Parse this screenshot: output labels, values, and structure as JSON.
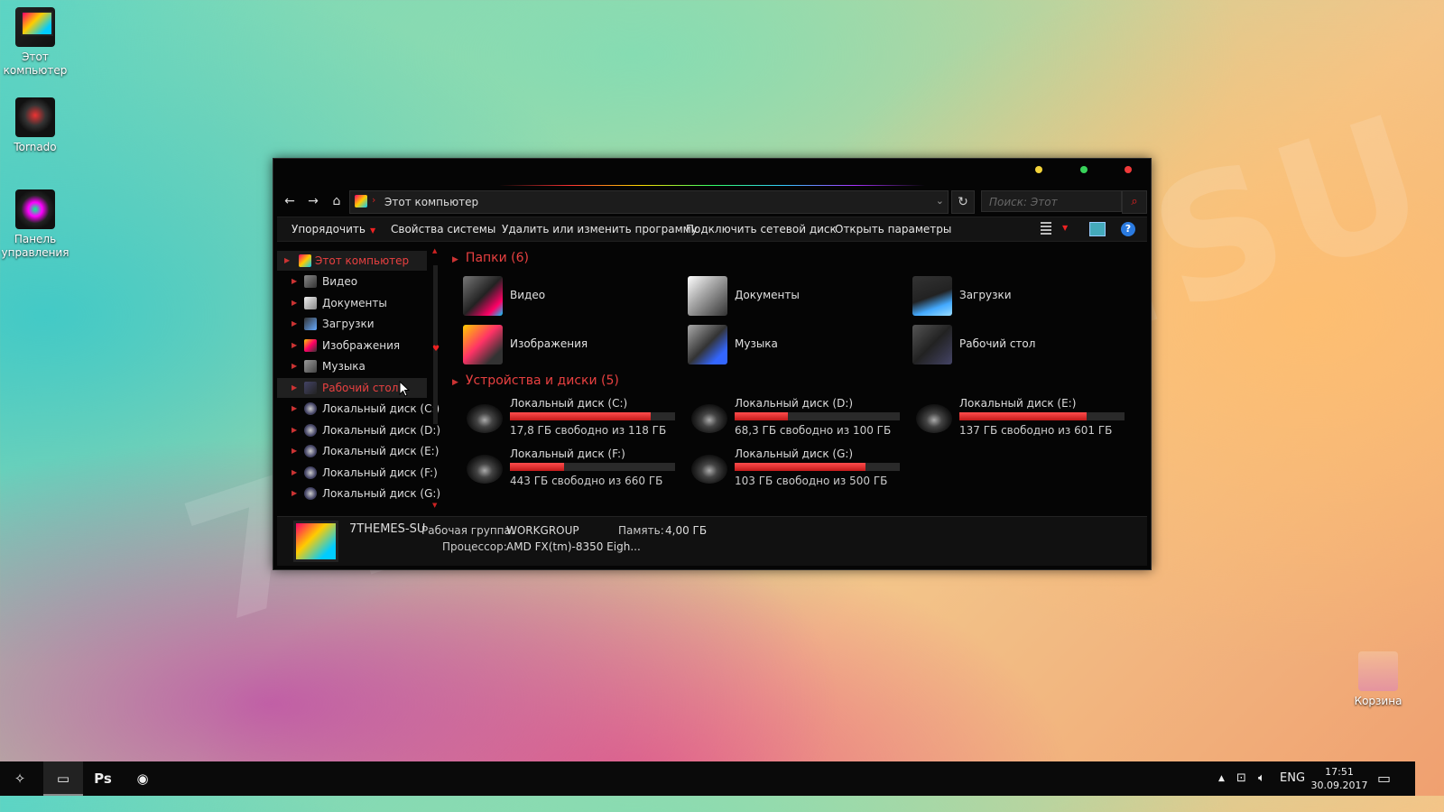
{
  "watermark": "7THEMES.SU",
  "desktop": {
    "icons": [
      {
        "label": "Этот компьютер",
        "icon": "computer-icon"
      },
      {
        "label": "Tornado",
        "icon": "tornado-icon"
      },
      {
        "label": "Панель управления",
        "icon": "control-panel-icon"
      },
      {
        "label": "Корзина",
        "icon": "recycle-bin-icon"
      }
    ]
  },
  "window": {
    "address": "Этот компьютер",
    "search_placeholder": "Поиск: Этот компьютер",
    "toolbar": {
      "organize": "Упорядочить",
      "system_properties": "Свойства системы",
      "uninstall": "Удалить или изменить программу",
      "map_drive": "Подключить сетевой диск",
      "open_settings": "Открыть параметры"
    },
    "sidebar": {
      "root": "Этот компьютер",
      "items": [
        "Видео",
        "Документы",
        "Загрузки",
        "Изображения",
        "Музыка",
        "Рабочий стол",
        "Локальный диск (C:)",
        "Локальный диск (D:)",
        "Локальный диск (E:)",
        "Локальный диск (F:)",
        "Локальный диск (G:)"
      ],
      "selected": "Рабочий стол"
    },
    "folders_header": "Папки (6)",
    "folders": [
      "Видео",
      "Документы",
      "Загрузки",
      "Изображения",
      "Музыка",
      "Рабочий стол"
    ],
    "drives_header": "Устройства и диски (5)",
    "drives": [
      {
        "name": "Локальный диск (C:)",
        "status": "17,8 ГБ свободно из 118 ГБ",
        "used_fraction": 0.85
      },
      {
        "name": "Локальный диск (D:)",
        "status": "68,3 ГБ свободно из 100 ГБ",
        "used_fraction": 0.32
      },
      {
        "name": "Локальный диск (E:)",
        "status": "137 ГБ свободно из 601 ГБ",
        "used_fraction": 0.77
      },
      {
        "name": "Локальный диск (F:)",
        "status": "443 ГБ свободно из 660 ГБ",
        "used_fraction": 0.33
      },
      {
        "name": "Локальный диск (G:)",
        "status": "103 ГБ свободно из 500 ГБ",
        "used_fraction": 0.79
      }
    ],
    "details": {
      "computer_name": "7THEMES-SU",
      "workgroup_label": "Рабочая группа:",
      "workgroup": "WORKGROUP",
      "memory_label": "Память:",
      "memory": "4,00 ГБ",
      "cpu_label": "Процессор:",
      "cpu": "AMD FX(tm)-8350 Eigh..."
    }
  },
  "taskbar": {
    "apps": [
      "start-button",
      "explorer",
      "photoshop",
      "chrome"
    ],
    "ps_label": "Ps",
    "lang": "ENG",
    "time": "17:51",
    "date": "30.09.2017"
  }
}
